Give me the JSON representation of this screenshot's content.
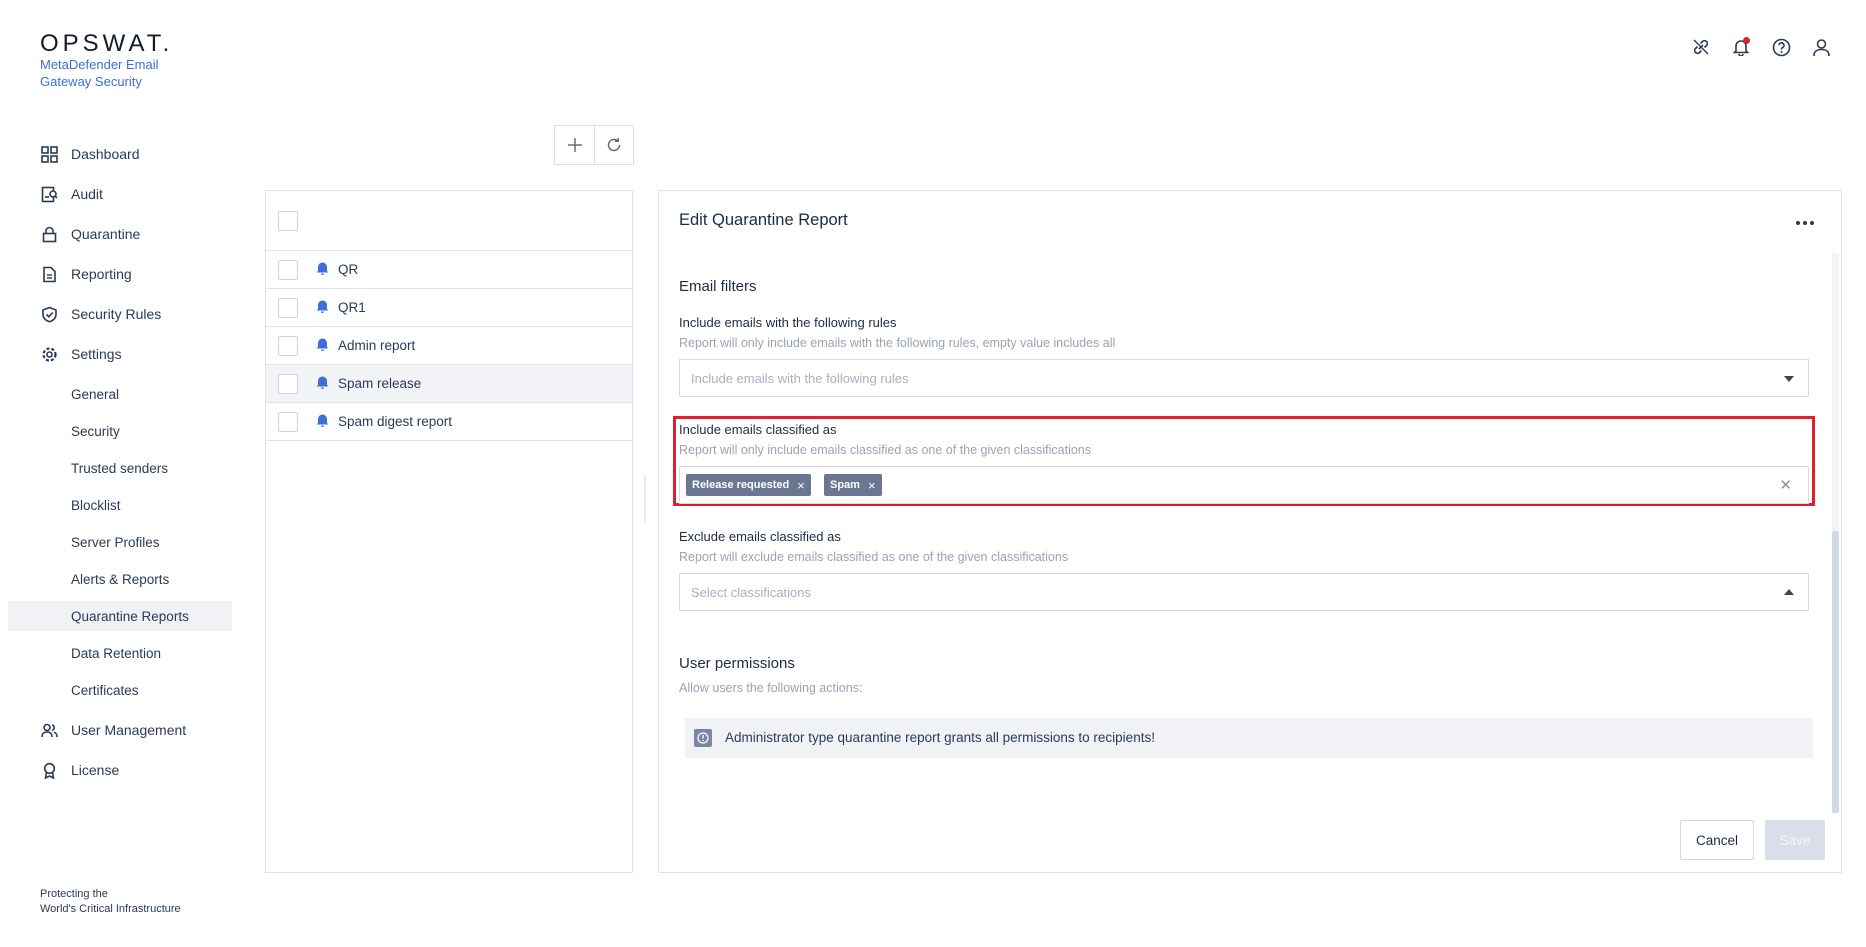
{
  "brand": {
    "logo": "OPSWAT.",
    "product": "MetaDefender Email Gateway Security",
    "footer_line1": "Protecting the",
    "footer_line2": "World's Critical Infrastructure"
  },
  "sidebar": {
    "items": [
      {
        "label": "Dashboard",
        "icon": "dashboard-icon"
      },
      {
        "label": "Audit",
        "icon": "audit-icon"
      },
      {
        "label": "Quarantine",
        "icon": "lock-icon"
      },
      {
        "label": "Reporting",
        "icon": "document-icon"
      },
      {
        "label": "Security Rules",
        "icon": "shield-check-icon"
      },
      {
        "label": "Settings",
        "icon": "gear-icon"
      },
      {
        "label": "User Management",
        "icon": "users-icon"
      },
      {
        "label": "License",
        "icon": "award-icon"
      }
    ],
    "settings_sub": [
      "General",
      "Security",
      "Trusted senders",
      "Blocklist",
      "Server Profiles",
      "Alerts & Reports",
      "Quarantine Reports",
      "Data Retention",
      "Certificates"
    ],
    "active_sub": "Quarantine Reports"
  },
  "topbar": {
    "icons": [
      "link-off-icon",
      "bell-icon",
      "help-icon",
      "user-icon"
    ]
  },
  "list": {
    "rows": [
      "QR",
      "QR1",
      "Admin report",
      "Spam release",
      "Spam digest report"
    ],
    "selected": "Spam release"
  },
  "edit": {
    "title": "Edit Quarantine Report",
    "email_filters_title": "Email filters",
    "rules": {
      "label": "Include emails with the following rules",
      "desc": "Report will only include emails with the following rules, empty value includes all",
      "placeholder": "Include emails with the following rules"
    },
    "include_classified": {
      "label": "Include emails classified as",
      "desc": "Report will only include emails classified as one of the given classifications",
      "tags": [
        "Release requested",
        "Spam"
      ]
    },
    "exclude_classified": {
      "label": "Exclude emails classified as",
      "desc": "Report will exclude emails classified as one of the given classifications",
      "placeholder": "Select classifications"
    },
    "permissions": {
      "title": "User permissions",
      "desc": "Allow users the following actions:",
      "info": "Administrator type quarantine report grants all permissions to recipients!"
    },
    "cancel_label": "Cancel",
    "save_label": "Save"
  },
  "colors": {
    "accent": "#3d6fd6",
    "highlight": "#e01e2d",
    "tag": "#6b7693"
  }
}
